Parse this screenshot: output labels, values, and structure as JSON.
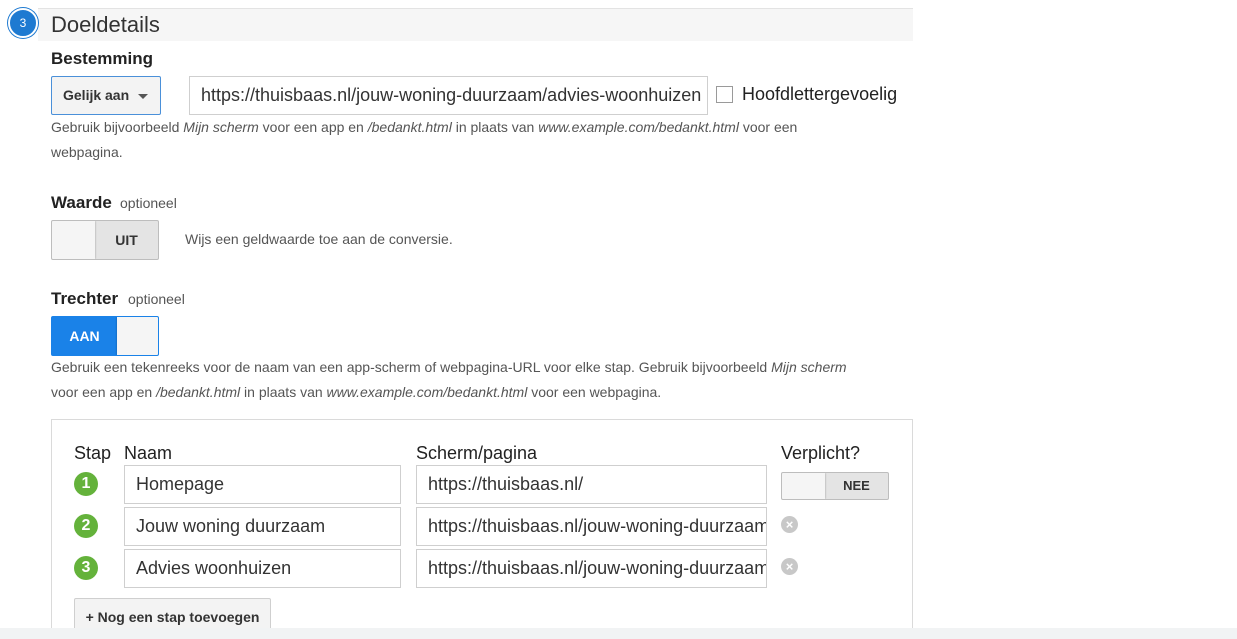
{
  "section": {
    "step_number": "3",
    "title": "Doeldetails"
  },
  "destination": {
    "label": "Bestemming",
    "match_type": "Gelijk aan",
    "url_value": "https://thuisbaas.nl/jouw-woning-duurzaam/advies-woonhuizen",
    "case_sensitive_label": "Hoofdlettergevoelig",
    "case_sensitive_checked": false,
    "help": {
      "part1": "Gebruik bijvoorbeeld ",
      "example_app": "Mijn scherm",
      "part2": " voor een app en ",
      "example_path": "/bedankt.html",
      "part3": " in plaats van ",
      "example_url": "www.example.com/bedankt.html",
      "part4": " voor een",
      "part5": "webpagina."
    }
  },
  "value": {
    "label": "Waarde",
    "optional": "optioneel",
    "toggle_state": "UIT",
    "description": "Wijs een geldwaarde toe aan de conversie."
  },
  "funnel": {
    "label": "Trechter",
    "optional": "optioneel",
    "toggle_state": "AAN",
    "help": {
      "part1": "Gebruik een tekenreeks voor de naam van een app-scherm of webpagina-URL voor elke stap. Gebruik bijvoorbeeld ",
      "example_app": "Mijn scherm",
      "part2": "voor een app en ",
      "example_path": "/bedankt.html",
      "part3": " in plaats van ",
      "example_url": "www.example.com/bedankt.html",
      "part4": " voor een webpagina."
    },
    "columns": {
      "step": "Stap",
      "name": "Naam",
      "page": "Scherm/pagina",
      "required": "Verplicht?"
    },
    "required_toggle": "NEE",
    "steps": [
      {
        "number": "1",
        "name": "Homepage",
        "page": "https://thuisbaas.nl/"
      },
      {
        "number": "2",
        "name": "Jouw woning duurzaam",
        "page": "https://thuisbaas.nl/jouw-woning-duurzaam/"
      },
      {
        "number": "3",
        "name": "Advies woonhuizen",
        "page": "https://thuisbaas.nl/jouw-woning-duurzaam/advies-woonhuizen"
      }
    ],
    "remove_icon": "×",
    "add_step_label": "+ Nog een stap toevoegen"
  },
  "colors": {
    "accent_blue": "#1a82e8",
    "step_green": "#64b23b",
    "badge_blue": "#1e7ad1"
  }
}
